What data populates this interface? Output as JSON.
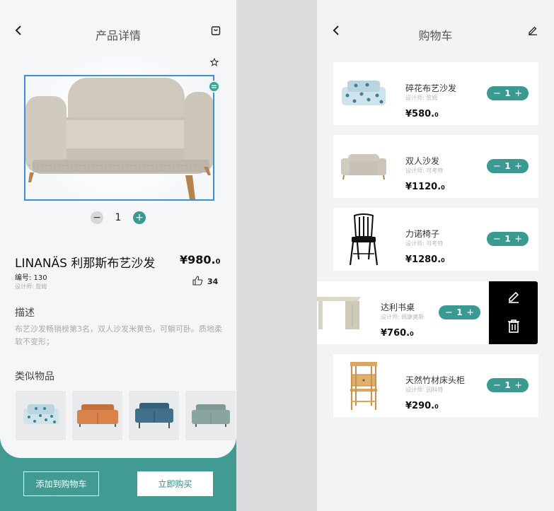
{
  "detail": {
    "title": "产品详情",
    "stepper_qty": "1",
    "product": {
      "name": "LINANÄS 利那斯布艺沙发",
      "price_main": "¥980.",
      "price_decimal": "0",
      "code": "编号: 130",
      "designer": "设计师: 詹姆",
      "likes": "34"
    },
    "description_title": "描述",
    "description_text": "布艺沙发畅销榜第3名，双人沙发米黄色，可躺可卧。质地柔软不变形；",
    "similar_title": "类似物品",
    "add_to_cart": "添加到购物车",
    "buy_now": "立即购买"
  },
  "cart": {
    "title": "购物车",
    "items": [
      {
        "name": "碎花布艺沙发",
        "designer": "设计师: 詹姆",
        "price_main": "¥580.",
        "price_decimal": "0",
        "qty": "1"
      },
      {
        "name": "双人沙发",
        "designer": "设计师: 可考特",
        "price_main": "¥1120.",
        "price_decimal": "0",
        "qty": "1"
      },
      {
        "name": "力诺椅子",
        "designer": "设计师: 可考特",
        "price_main": "¥1280.",
        "price_decimal": "0",
        "qty": "1"
      },
      {
        "name": "达利书桌",
        "designer": "设计师: 佩康奥斯",
        "price_main": "¥760.",
        "price_decimal": "0",
        "qty": "1"
      },
      {
        "name": "天然竹材床头柜",
        "designer": "设计师: 因科特",
        "price_main": "¥290.",
        "price_decimal": "0",
        "qty": "1"
      }
    ]
  },
  "colors": {
    "accent": "#3a9990",
    "footer": "#429b92",
    "selection": "#3a8fe0"
  }
}
